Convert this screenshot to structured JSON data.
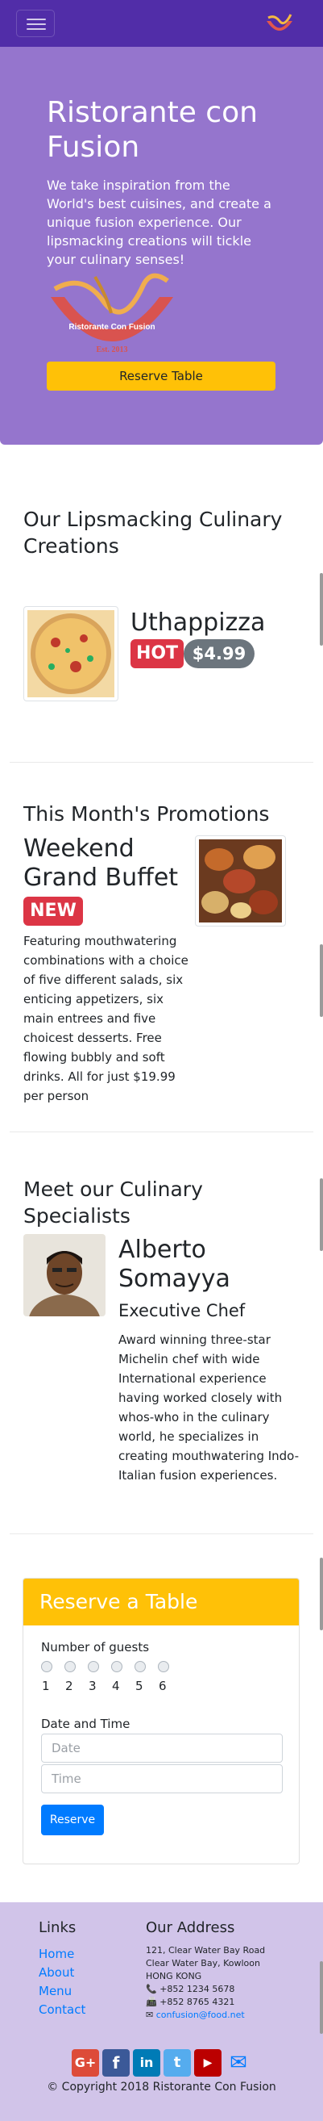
{
  "navbar": {
    "menu_icon": "hamburger-icon",
    "logo_icon": "restaurant-logo"
  },
  "jumbotron": {
    "title": "Ristorante con Fusion",
    "description": "We take inspiration from the World's best cuisines, and create a unique fusion experience. Our lipsmacking creations will tickle your culinary senses!",
    "logo_text": "Ristorante Con Fusion",
    "logo_est": "Est. 2013",
    "reserve_button": "Reserve Table"
  },
  "creations": {
    "title": "Our Lipsmacking Culinary Creations",
    "dish_name": "Uthappizza",
    "badge_hot": "HOT",
    "badge_price": "$4.99"
  },
  "promotions": {
    "title": "This Month's Promotions",
    "name": "Weekend Grand Buffet",
    "badge_new": "NEW",
    "description": "Featuring mouthwatering combinations with a choice of five different salads, six enticing appetizers, six main entrees and five choicest desserts. Free flowing bubbly and soft drinks. All for just $19.99 per person"
  },
  "specialists": {
    "title": "Meet our Culinary Specialists",
    "name": "Alberto Somayya",
    "role": "Executive Chef",
    "description": "Award winning three-star Michelin chef with wide International experience having worked closely with whos-who in the culinary world, he specializes in creating mouthwatering Indo-Italian fusion experiences."
  },
  "reserve": {
    "title": "Reserve a Table",
    "guests_label": "Number of guests",
    "guest_options": [
      "1",
      "2",
      "3",
      "4",
      "5",
      "6"
    ],
    "datetime_label": "Date and Time",
    "date_placeholder": "Date",
    "time_placeholder": "Time",
    "submit_label": "Reserve"
  },
  "footer": {
    "links_title": "Links",
    "links": [
      "Home",
      "About",
      "Menu",
      "Contact"
    ],
    "address_title": "Our Address",
    "address_lines": [
      "121, Clear Water Bay Road",
      "Clear Water Bay, Kowloon",
      "HONG KONG"
    ],
    "phone": "+852 1234 5678",
    "fax": "+852 8765 4321",
    "email": "confusion@food.net",
    "social": [
      "G+",
      "f",
      "in",
      "t",
      "▶",
      "✉"
    ],
    "copyright": "© Copyright 2018 Ristorante Con Fusion"
  },
  "colors": {
    "navbar": "#512da8",
    "jumbotron": "#9575cd",
    "accent": "#ffc107",
    "footer": "#d1c4e9",
    "danger": "#dc3545",
    "link": "#007bff"
  }
}
